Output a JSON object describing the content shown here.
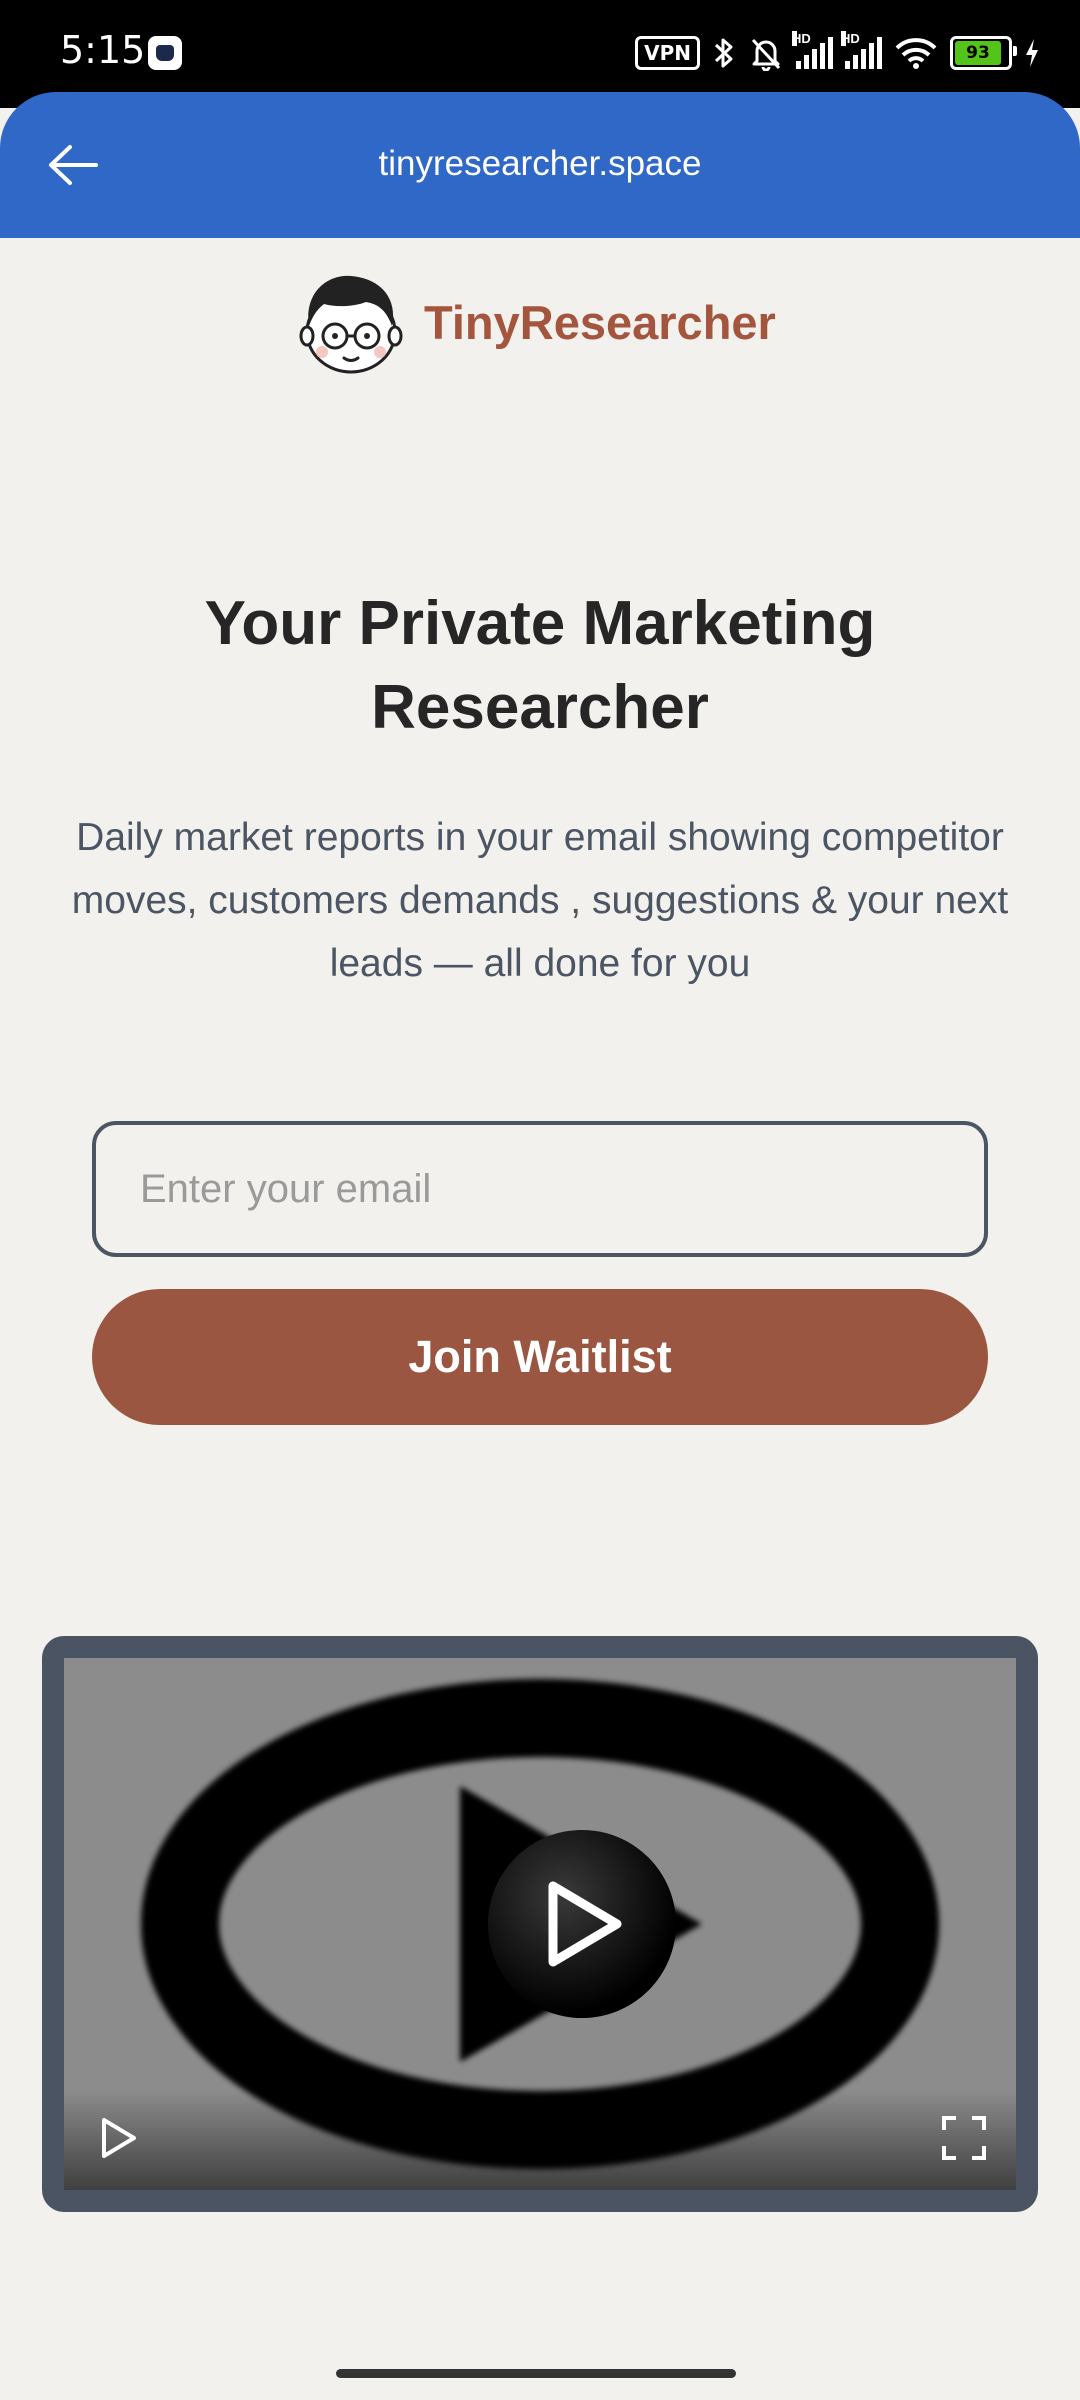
{
  "status_bar": {
    "time": "5:15",
    "vpn_label": "VPN",
    "hd_label": "HD",
    "battery_level": "93",
    "icons": [
      "app-notification-icon",
      "vpn-icon",
      "bluetooth-icon",
      "bell-off-icon",
      "signal-icon",
      "wifi-icon",
      "battery-icon",
      "charging-icon"
    ]
  },
  "app_bar": {
    "title": "tinyresearcher.space",
    "back_icon": "arrow-left-icon",
    "color": "#2f68c6"
  },
  "brand": {
    "name": "TinyResearcher",
    "color": "#a3553e",
    "logo_icon": "researcher-avatar-icon"
  },
  "hero": {
    "title": "Your Private Marketing Researcher",
    "subtitle": "Daily market reports in your email showing competitor moves, customers demands , suggestions & your next leads — all done for you"
  },
  "form": {
    "email_placeholder": "Enter your email",
    "email_value": "",
    "submit_label": "Join Waitlist",
    "button_color": "#9a5640"
  },
  "video": {
    "icons": [
      "play-icon",
      "fullscreen-icon"
    ]
  }
}
